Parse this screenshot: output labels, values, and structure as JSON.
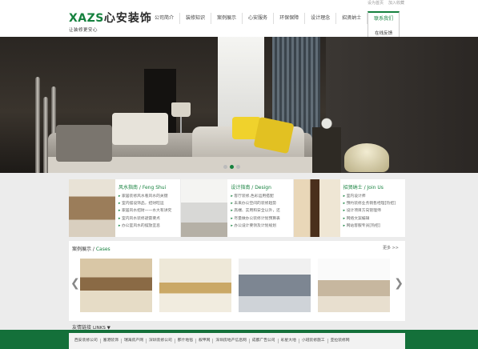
{
  "header": {
    "logo_en": "XAZS",
    "logo_cn": "心安装饰",
    "slogan": "让装修更安心",
    "toplinks": [
      "设为首页",
      "加入收藏"
    ]
  },
  "nav": {
    "items": [
      "公司简介",
      "装修知识",
      "案例展示",
      "心安服务",
      "环保保障",
      "设计理念",
      "招贤纳士",
      "联系我们"
    ],
    "active_index": 7,
    "dropdown_item": "在线反馈"
  },
  "banner": {
    "slide_count": 3,
    "active_slide": 2
  },
  "columns": [
    {
      "title_cn": "风水指南",
      "title_en": "Feng Shui",
      "items": [
        "家居装修风水看风水的关键",
        "室内摆设饰品，招财旺运",
        "家居风水招财——水大有讲究",
        "室内风水装修避雷要点",
        "办公室风水的摆放宜忌"
      ]
    },
    {
      "title_cn": "设计指南",
      "title_en": "Design",
      "items": [
        "客厅装修,色彩运用搭配",
        "未来办公空间的装修趋势",
        "高端、实用和安全以外，还",
        "尽量做办公装修计划预算表",
        "办公设计要领及计划规划"
      ]
    },
    {
      "title_cn": "招贤纳士",
      "title_en": "Join Us",
      "items": [
        "室内设计师",
        "预约装修业务销售经理[热招]",
        "设计项目方向管理师",
        "网络文案编辑",
        "网站客服专员[热招]"
      ]
    }
  ],
  "cases": {
    "title_cn": "案例展示",
    "title_en": "Cases",
    "more_label": "更多 >>",
    "prev_icon": "❮",
    "next_icon": "❯",
    "count": 4
  },
  "links": {
    "title_cn": "友情链接",
    "title_en": "LINKS ▼",
    "items": [
      "西安装修公司",
      "塞港装饰",
      "瑞海房产网",
      "深圳装修公司",
      "那什地毯",
      "叙甲网",
      "深圳房地产信息网",
      "成都广告公司",
      "彩星大地",
      "小班装修施工",
      "亚拉装修网"
    ]
  },
  "colors": {
    "brand_green": "#15813e",
    "footer_green": "#14703a"
  }
}
